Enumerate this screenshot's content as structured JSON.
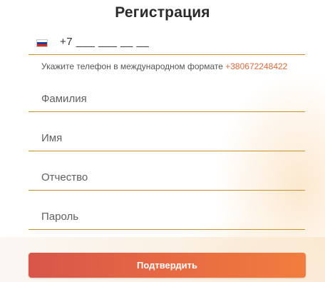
{
  "title": "Регистрация",
  "phone": {
    "country_icon": "russia-flag-icon",
    "value": "+7 ___ ___ __ __",
    "hint_text": "Укажите телефон в международном формате",
    "hint_example": "+380672248422"
  },
  "fields": {
    "lastname_placeholder": "Фамилия",
    "firstname_placeholder": "Имя",
    "middlename_placeholder": "Отчество",
    "password_placeholder": "Пароль"
  },
  "submit_label": "Подтвердить",
  "colors": {
    "underline": "#c8912c",
    "accent": "#e06a3c",
    "button_start": "#d8554a",
    "button_end": "#f17d3e"
  }
}
